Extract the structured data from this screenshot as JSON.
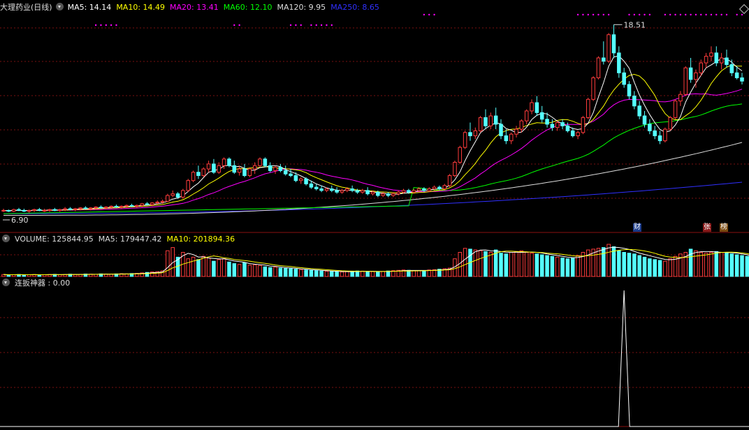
{
  "header": {
    "stock_title": "大理药业(日线)",
    "ma5": "MA5: 14.14",
    "ma10": "MA10: 14.49",
    "ma20": "MA20: 13.41",
    "ma60": "MA60: 12.10",
    "ma120": "MA120: 9.95",
    "ma250": "MA250: 8.65",
    "volume": "VOLUME: 125844.95",
    "vol_ma5": "MA5: 179447.42",
    "vol_ma10": "MA10: 201894.36",
    "indicator": "连扳神器 : 0.00"
  },
  "labels": {
    "high_price": "18.51",
    "low_price": "6.90",
    "badge_cai": "财",
    "badge_zhang": "张",
    "badge_bang": "榜"
  },
  "colors": {
    "up": "#ff3c3c",
    "down": "#54ffff",
    "ma5": "#ffffff",
    "ma10": "#ffff00",
    "ma20": "#ff00ff",
    "ma60": "#00ff00",
    "ma120": "#dddddd",
    "ma250": "#3030ff",
    "grid": "#7a1010"
  },
  "chart_data": {
    "type": "candlestick",
    "price_high": 18.51,
    "price_low": 6.9,
    "candles": [
      [
        7.3,
        7.4,
        7.2,
        7.3
      ],
      [
        7.3,
        7.35,
        7.2,
        7.25
      ],
      [
        7.25,
        7.4,
        7.2,
        7.35
      ],
      [
        7.35,
        7.45,
        7.25,
        7.3
      ],
      [
        7.3,
        7.4,
        7.2,
        7.25
      ],
      [
        7.25,
        7.35,
        7.15,
        7.3
      ],
      [
        7.3,
        7.4,
        7.2,
        7.35
      ],
      [
        7.35,
        7.45,
        7.25,
        7.3
      ],
      [
        7.3,
        7.4,
        7.2,
        7.3
      ],
      [
        7.3,
        7.4,
        7.2,
        7.35
      ],
      [
        7.35,
        7.45,
        7.25,
        7.3
      ],
      [
        7.3,
        7.4,
        7.2,
        7.35
      ],
      [
        7.35,
        7.5,
        7.25,
        7.4
      ],
      [
        7.4,
        7.5,
        7.3,
        7.35
      ],
      [
        7.35,
        7.45,
        7.25,
        7.4
      ],
      [
        7.4,
        7.5,
        7.3,
        7.45
      ],
      [
        7.45,
        7.55,
        7.35,
        7.4
      ],
      [
        7.4,
        7.5,
        7.3,
        7.45
      ],
      [
        7.45,
        7.55,
        7.35,
        7.5
      ],
      [
        7.5,
        7.6,
        7.4,
        7.45
      ],
      [
        7.45,
        7.55,
        7.35,
        7.5
      ],
      [
        7.5,
        7.6,
        7.4,
        7.55
      ],
      [
        7.55,
        7.65,
        7.45,
        7.5
      ],
      [
        7.5,
        7.6,
        7.4,
        7.55
      ],
      [
        7.55,
        7.65,
        7.45,
        7.6
      ],
      [
        7.6,
        7.7,
        7.5,
        7.55
      ],
      [
        7.55,
        7.65,
        7.45,
        7.6
      ],
      [
        7.6,
        7.75,
        7.5,
        7.7
      ],
      [
        7.7,
        7.8,
        7.6,
        7.65
      ],
      [
        7.65,
        7.8,
        7.55,
        7.75
      ],
      [
        7.75,
        7.9,
        7.65,
        7.8
      ],
      [
        7.8,
        7.95,
        7.7,
        7.85
      ],
      [
        7.85,
        8.3,
        7.8,
        8.2
      ],
      [
        8.2,
        8.5,
        8.1,
        8.3
      ],
      [
        8.3,
        8.4,
        8.0,
        8.1
      ],
      [
        8.1,
        8.6,
        8.0,
        8.5
      ],
      [
        8.5,
        9.2,
        8.4,
        9.1
      ],
      [
        9.1,
        9.7,
        9.0,
        9.6
      ],
      [
        9.6,
        10.0,
        9.2,
        9.4
      ],
      [
        9.4,
        9.9,
        9.3,
        9.8
      ],
      [
        9.8,
        10.3,
        9.6,
        10.1
      ],
      [
        10.1,
        10.4,
        9.5,
        9.6
      ],
      [
        9.6,
        10.2,
        9.5,
        10.0
      ],
      [
        10.0,
        10.5,
        9.8,
        10.4
      ],
      [
        10.4,
        10.5,
        9.9,
        10.0
      ],
      [
        10.0,
        10.3,
        9.5,
        9.6
      ],
      [
        9.6,
        10.0,
        9.4,
        9.8
      ],
      [
        9.8,
        10.1,
        9.3,
        9.4
      ],
      [
        9.4,
        9.9,
        9.3,
        9.8
      ],
      [
        9.8,
        10.2,
        9.5,
        10.0
      ],
      [
        10.0,
        10.5,
        9.9,
        10.4
      ],
      [
        10.4,
        10.5,
        9.9,
        10.0
      ],
      [
        10.0,
        10.2,
        9.6,
        9.7
      ],
      [
        9.7,
        10.0,
        9.5,
        9.9
      ],
      [
        9.9,
        10.1,
        9.6,
        9.7
      ],
      [
        9.7,
        10.0,
        9.4,
        9.5
      ],
      [
        9.5,
        9.8,
        9.3,
        9.4
      ],
      [
        9.4,
        9.6,
        9.0,
        9.1
      ],
      [
        9.1,
        9.3,
        8.9,
        9.2
      ],
      [
        9.2,
        9.3,
        8.8,
        8.9
      ],
      [
        8.9,
        9.1,
        8.6,
        8.7
      ],
      [
        8.7,
        8.9,
        8.5,
        8.6
      ],
      [
        8.6,
        8.8,
        8.4,
        8.5
      ],
      [
        8.5,
        8.7,
        8.4,
        8.6
      ],
      [
        8.6,
        8.8,
        8.4,
        8.5
      ],
      [
        8.5,
        8.7,
        8.3,
        8.4
      ],
      [
        8.4,
        8.6,
        8.3,
        8.5
      ],
      [
        8.5,
        8.7,
        8.4,
        8.6
      ],
      [
        8.6,
        8.8,
        8.4,
        8.5
      ],
      [
        8.5,
        8.6,
        8.3,
        8.4
      ],
      [
        8.4,
        8.6,
        8.3,
        8.5
      ],
      [
        8.5,
        8.7,
        8.2,
        8.3
      ],
      [
        8.3,
        8.5,
        8.2,
        8.4
      ],
      [
        8.4,
        8.5,
        8.1,
        8.2
      ],
      [
        8.2,
        8.4,
        8.1,
        8.3
      ],
      [
        8.3,
        8.4,
        8.1,
        8.2
      ],
      [
        8.2,
        8.4,
        8.1,
        8.3
      ],
      [
        8.3,
        8.5,
        8.2,
        8.4
      ],
      [
        8.4,
        8.6,
        8.3,
        8.5
      ],
      [
        8.5,
        8.6,
        8.3,
        8.4
      ],
      [
        8.4,
        8.6,
        8.3,
        8.5
      ],
      [
        8.5,
        8.7,
        8.4,
        8.6
      ],
      [
        8.6,
        8.7,
        8.4,
        8.5
      ],
      [
        8.5,
        8.7,
        8.4,
        8.6
      ],
      [
        8.6,
        8.8,
        8.5,
        8.7
      ],
      [
        8.7,
        8.8,
        8.5,
        8.6
      ],
      [
        8.6,
        8.9,
        8.5,
        8.8
      ],
      [
        8.8,
        9.5,
        8.7,
        9.4
      ],
      [
        9.4,
        10.3,
        9.3,
        10.2
      ],
      [
        10.2,
        11.2,
        10.1,
        11.1
      ],
      [
        11.1,
        12.1,
        11.0,
        12.0
      ],
      [
        12.0,
        12.6,
        11.5,
        11.8
      ],
      [
        11.8,
        12.3,
        11.6,
        12.1
      ],
      [
        12.1,
        13.0,
        12.0,
        12.9
      ],
      [
        12.9,
        13.4,
        12.2,
        12.4
      ],
      [
        12.4,
        13.2,
        12.2,
        13.0
      ],
      [
        13.0,
        13.5,
        12.2,
        12.5
      ],
      [
        12.5,
        12.8,
        11.6,
        11.8
      ],
      [
        11.8,
        12.2,
        11.3,
        11.5
      ],
      [
        11.5,
        12.0,
        11.3,
        11.9
      ],
      [
        11.9,
        12.4,
        11.7,
        12.2
      ],
      [
        12.2,
        12.8,
        12.0,
        12.7
      ],
      [
        12.7,
        13.4,
        12.5,
        13.3
      ],
      [
        13.3,
        14.0,
        13.1,
        13.8
      ],
      [
        13.8,
        14.2,
        13.0,
        13.2
      ],
      [
        13.2,
        13.6,
        12.6,
        12.8
      ],
      [
        12.8,
        13.2,
        12.3,
        12.5
      ],
      [
        12.5,
        12.8,
        12.1,
        12.3
      ],
      [
        12.3,
        12.7,
        12.1,
        12.6
      ],
      [
        12.6,
        12.8,
        12.2,
        12.4
      ],
      [
        12.4,
        12.6,
        12.0,
        12.1
      ],
      [
        12.1,
        12.3,
        11.7,
        11.8
      ],
      [
        11.8,
        12.1,
        11.6,
        12.0
      ],
      [
        12.0,
        13.0,
        11.9,
        12.9
      ],
      [
        12.9,
        14.1,
        12.8,
        14.0
      ],
      [
        14.0,
        15.4,
        13.9,
        15.3
      ],
      [
        15.3,
        16.6,
        15.2,
        16.5
      ],
      [
        16.5,
        17.5,
        16.1,
        16.3
      ],
      [
        16.3,
        18.0,
        16.2,
        17.9
      ],
      [
        17.9,
        18.51,
        16.5,
        16.8
      ],
      [
        16.8,
        17.2,
        15.3,
        15.6
      ],
      [
        15.6,
        15.9,
        14.7,
        14.9
      ],
      [
        14.9,
        15.1,
        14.0,
        14.2
      ],
      [
        14.2,
        14.5,
        13.4,
        13.6
      ],
      [
        13.6,
        13.9,
        12.8,
        13.0
      ],
      [
        13.0,
        13.3,
        12.3,
        12.5
      ],
      [
        12.5,
        12.8,
        11.9,
        12.1
      ],
      [
        12.1,
        12.4,
        11.6,
        11.8
      ],
      [
        11.8,
        12.1,
        11.3,
        11.5
      ],
      [
        11.5,
        12.3,
        11.4,
        12.2
      ],
      [
        12.2,
        13.0,
        12.1,
        12.9
      ],
      [
        12.9,
        14.0,
        12.8,
        13.9
      ],
      [
        13.9,
        14.5,
        13.6,
        14.3
      ],
      [
        14.3,
        16.0,
        14.2,
        15.9
      ],
      [
        15.9,
        16.5,
        15.0,
        15.2
      ],
      [
        15.2,
        15.8,
        14.7,
        15.6
      ],
      [
        15.6,
        16.4,
        15.4,
        16.2
      ],
      [
        16.2,
        16.8,
        15.9,
        16.6
      ],
      [
        16.6,
        17.2,
        16.3,
        16.8
      ],
      [
        16.8,
        17.2,
        16.0,
        16.2
      ],
      [
        16.2,
        16.8,
        15.8,
        16.5
      ],
      [
        16.5,
        17.0,
        15.9,
        16.1
      ],
      [
        16.1,
        16.4,
        15.4,
        15.6
      ],
      [
        15.6,
        16.0,
        15.2,
        15.3
      ],
      [
        15.3,
        15.6,
        14.9,
        15.1
      ]
    ],
    "volume": [
      12,
      10,
      11,
      12,
      10,
      11,
      12,
      10,
      11,
      12,
      13,
      11,
      12,
      14,
      12,
      13,
      15,
      14,
      13,
      16,
      15,
      14,
      16,
      17,
      16,
      18,
      19,
      22,
      25,
      28,
      30,
      35,
      160,
      180,
      120,
      150,
      110,
      120,
      105,
      125,
      115,
      95,
      105,
      110,
      90,
      80,
      75,
      85,
      70,
      72,
      68,
      60,
      55,
      58,
      52,
      50,
      48,
      45,
      42,
      40,
      38,
      36,
      34,
      32,
      30,
      29,
      28,
      30,
      32,
      34,
      33,
      31,
      30,
      29,
      31,
      34,
      36,
      38,
      40,
      38,
      36,
      35,
      37,
      40,
      42,
      45,
      48,
      52,
      110,
      150,
      175,
      170,
      165,
      160,
      155,
      150,
      165,
      145,
      140,
      150,
      155,
      160,
      150,
      145,
      140,
      135,
      130,
      125,
      120,
      115,
      110,
      115,
      130,
      150,
      165,
      170,
      175,
      180,
      200,
      185,
      160,
      150,
      145,
      140,
      130,
      120,
      110,
      105,
      100,
      95,
      110,
      125,
      140,
      150,
      170,
      160,
      150,
      145,
      150,
      155,
      150,
      145,
      140,
      135,
      130,
      125,
      90
    ],
    "indicator_peak_index": 121,
    "indicator_value": 0.0
  }
}
